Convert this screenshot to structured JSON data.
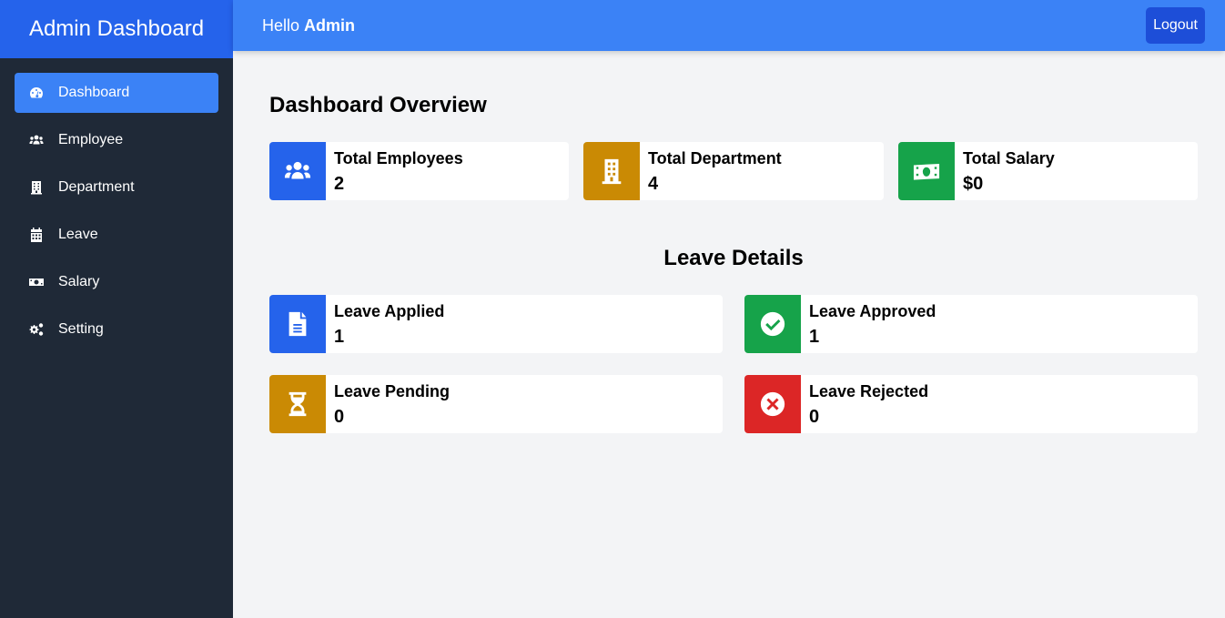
{
  "sidebar": {
    "brand": "Admin Dashboard",
    "items": [
      {
        "label": "Dashboard",
        "icon": "gauge-icon",
        "active": true
      },
      {
        "label": "Employee",
        "icon": "users-icon"
      },
      {
        "label": "Department",
        "icon": "building-icon"
      },
      {
        "label": "Leave",
        "icon": "calendar-icon"
      },
      {
        "label": "Salary",
        "icon": "money-bill-icon"
      },
      {
        "label": "Setting",
        "icon": "cogs-icon"
      }
    ]
  },
  "topbar": {
    "greeting": "Hello",
    "user": "Admin",
    "logout_label": "Logout"
  },
  "overview": {
    "title": "Dashboard Overview",
    "cards": [
      {
        "label": "Total Employees",
        "value": "2",
        "icon": "users-icon",
        "color": "#2563eb"
      },
      {
        "label": "Total Department",
        "value": "4",
        "icon": "building-icon",
        "color": "#ca8a04"
      },
      {
        "label": "Total Salary",
        "value": "$0",
        "icon": "money-bill-icon",
        "color": "#16a34a"
      }
    ]
  },
  "leave": {
    "title": "Leave Details",
    "cards": [
      {
        "label": "Leave Applied",
        "value": "1",
        "icon": "file-lines-icon",
        "color": "#2563eb"
      },
      {
        "label": "Leave Approved",
        "value": "1",
        "icon": "circle-check-icon",
        "color": "#16a34a"
      },
      {
        "label": "Leave Pending",
        "value": "0",
        "icon": "hourglass-icon",
        "color": "#ca8a04"
      },
      {
        "label": "Leave Rejected",
        "value": "0",
        "icon": "circle-xmark-icon",
        "color": "#dc2626"
      }
    ]
  }
}
